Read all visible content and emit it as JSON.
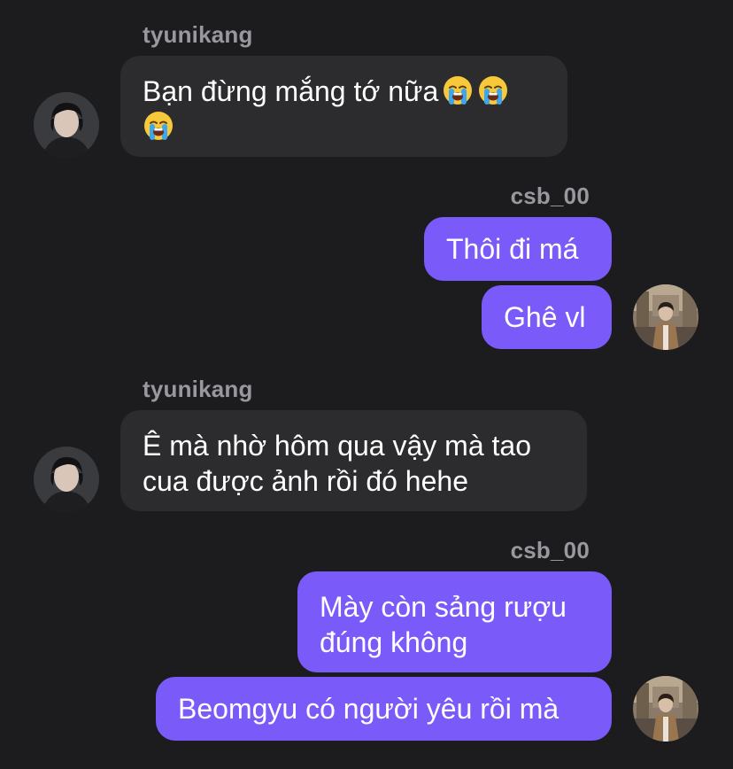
{
  "thread": {
    "messages": [
      {
        "sender": "tyunikang",
        "text": "Bạn đừng mắng tớ nữa",
        "emoji": [
          "loudly-crying-face",
          "loudly-crying-face",
          "loudly-crying-face"
        ]
      },
      {
        "sender": "csb_00",
        "text": "Thôi đi má"
      },
      {
        "sender": "csb_00",
        "text": "Ghê vl"
      },
      {
        "sender": "tyunikang",
        "text": "Ê mà nhờ hôm qua vậy mà tao\ncua được ảnh rồi đó hehe"
      },
      {
        "sender": "csb_00",
        "text": "Mày còn sảng rượu\nđúng không"
      },
      {
        "sender": "csb_00",
        "text": "Beomgyu có người yêu rồi mà"
      }
    ],
    "senders": {
      "incoming": "tyunikang",
      "outgoing": "csb_00"
    }
  },
  "colors": {
    "background": "#1c1c1e",
    "incoming_bubble": "#2c2c2e",
    "outgoing_bubble": "#7a5af8",
    "sender_label": "#98989f",
    "text": "#ffffff"
  },
  "icons": {
    "emoji": "loudly-crying-face",
    "incoming_avatar": "avatar-tyunikang",
    "outgoing_avatar": "avatar-csb_00"
  }
}
